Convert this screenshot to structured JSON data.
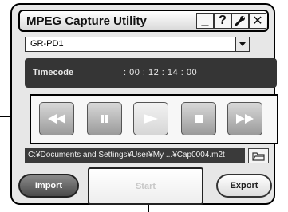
{
  "window": {
    "title": "MPEG Capture Utility"
  },
  "window_buttons": {
    "minimize": "_",
    "help": "?",
    "close": "✕"
  },
  "device": {
    "selected": "GR-PD1"
  },
  "timecode": {
    "label": "Timecode",
    "value": ": 00 : 12 : 14 : 00"
  },
  "file": {
    "path": "C:¥Documents and Settings¥User¥My ...¥Cap0004.m2t"
  },
  "buttons": {
    "import": "Import",
    "start": "Start",
    "export": "Export"
  }
}
